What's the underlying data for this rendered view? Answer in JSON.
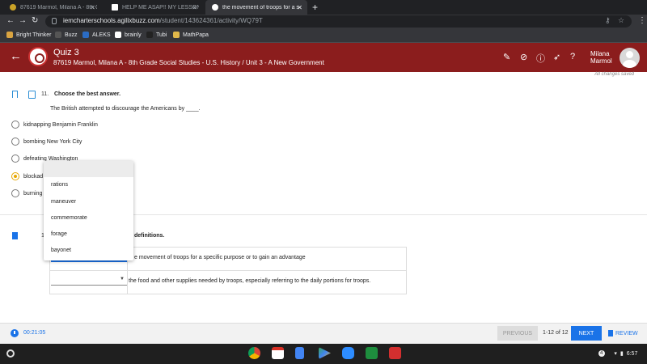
{
  "browser": {
    "tabs": [
      {
        "title": "87619 Marmol, Milana A - 8th Gr",
        "active": false
      },
      {
        "title": "HELP ME ASAP!! MY LESSON IS",
        "active": false
      },
      {
        "title": "the movement of troops for a sp",
        "active": true
      }
    ],
    "new_tab_symbol": "+",
    "tab_close_symbol": "✕",
    "url_host": "iemcharterschools.agilixbuzz.com",
    "url_path": "/student/143624361/activity/WQ79T",
    "bookmarks": [
      "Bright Thinker",
      "Buzz",
      "ALEKS",
      "brainly",
      "Tubi",
      "MathPapa"
    ]
  },
  "header": {
    "title": "Quiz 3",
    "subtitle": "87619 Marmol, Milana A - 8th Grade Social Studies - U.S. History / Unit 3 - A New Government",
    "user_first": "Milana",
    "user_last": "Marmol",
    "saved_status": "All changes saved",
    "brand_color": "#8b1d1d"
  },
  "question11": {
    "number": "11.",
    "heading": "Choose the best answer.",
    "prompt": "The British attempted to discourage the Americans by ____.",
    "options": [
      {
        "label": "kidnapping Benjamin Franklin",
        "selected": false
      },
      {
        "label": "bombing New York City",
        "selected": false
      },
      {
        "label": "defeating Washington",
        "selected": false
      },
      {
        "label": "blockad",
        "selected": true
      },
      {
        "label": "burning",
        "selected": false
      }
    ]
  },
  "question12": {
    "number_partial": "1",
    "heading_partial": "definitions.",
    "definitions": [
      "e movement of troops for a specific purpose or to gain an advantage",
      "the food and other supplies needed by troops, especially referring to the daily portions for troops."
    ]
  },
  "dropdown": {
    "items": [
      "rations",
      "maneuver",
      "commemorate",
      "forage",
      "bayonet"
    ]
  },
  "footer": {
    "timer": "00:21:05",
    "previous_label": "PREVIOUS",
    "pager": "1-12 of 12",
    "next_label": "NEXT",
    "review_label": "REVIEW",
    "accent_color": "#1a73e8"
  },
  "shelf": {
    "apps": [
      "chrome-icon",
      "gmail-icon",
      "docs-icon",
      "play-store-icon",
      "zoom-icon",
      "classroom-icon",
      "mcgraw-hill-icon"
    ],
    "time": "6:57",
    "notification_count": "4"
  }
}
